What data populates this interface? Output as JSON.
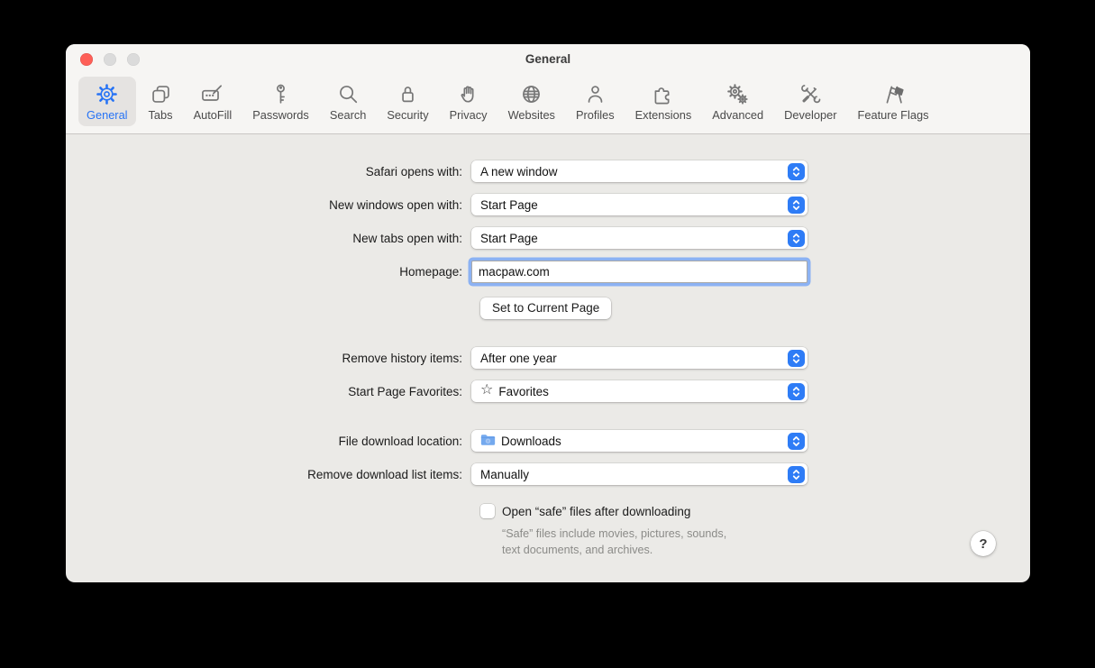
{
  "window": {
    "title": "General"
  },
  "toolbar": {
    "tabs": [
      {
        "label": "General",
        "icon": "gear-icon",
        "selected": true
      },
      {
        "label": "Tabs",
        "icon": "tabs-icon",
        "selected": false
      },
      {
        "label": "AutoFill",
        "icon": "autofill-icon",
        "selected": false
      },
      {
        "label": "Passwords",
        "icon": "key-icon",
        "selected": false
      },
      {
        "label": "Search",
        "icon": "magnifier-icon",
        "selected": false
      },
      {
        "label": "Security",
        "icon": "lock-icon",
        "selected": false
      },
      {
        "label": "Privacy",
        "icon": "hand-icon",
        "selected": false
      },
      {
        "label": "Websites",
        "icon": "globe-icon",
        "selected": false
      },
      {
        "label": "Profiles",
        "icon": "person-icon",
        "selected": false
      },
      {
        "label": "Extensions",
        "icon": "puzzle-icon",
        "selected": false
      },
      {
        "label": "Advanced",
        "icon": "gears-icon",
        "selected": false
      },
      {
        "label": "Developer",
        "icon": "tools-icon",
        "selected": false
      },
      {
        "label": "Feature Flags",
        "icon": "flags-icon",
        "selected": false
      }
    ]
  },
  "form": {
    "open_rows": [
      {
        "label": "Safari opens with:",
        "value": "A new window"
      },
      {
        "label": "New windows open with:",
        "value": "Start Page"
      },
      {
        "label": "New tabs open with:",
        "value": "Start Page"
      }
    ],
    "homepage": {
      "label": "Homepage:",
      "value": "macpaw.com"
    },
    "set_button_label": "Set to Current Page",
    "history_rows": [
      {
        "label": "Remove history items:",
        "value": "After one year"
      },
      {
        "label": "Start Page Favorites:",
        "value": "Favorites",
        "icon": "star-icon",
        "star_glyph": "☆"
      }
    ],
    "download_rows": [
      {
        "label": "File download location:",
        "value": "Downloads",
        "icon": "downloads-folder-icon"
      },
      {
        "label": "Remove download list items:",
        "value": "Manually"
      }
    ],
    "safe_files": {
      "checkbox_label": "Open “safe” files after downloading",
      "checked": false,
      "note_line1": "“Safe” files include movies, pictures, sounds,",
      "note_line2": "text documents, and archives."
    },
    "help_label": "?"
  },
  "colors": {
    "accent_blue": "#2e7cf6",
    "selected_tab_blue": "#2673f5",
    "traffic_red": "#fe5f57",
    "toolbar_bg": "#f6f5f3",
    "content_bg": "#ebeae7"
  }
}
